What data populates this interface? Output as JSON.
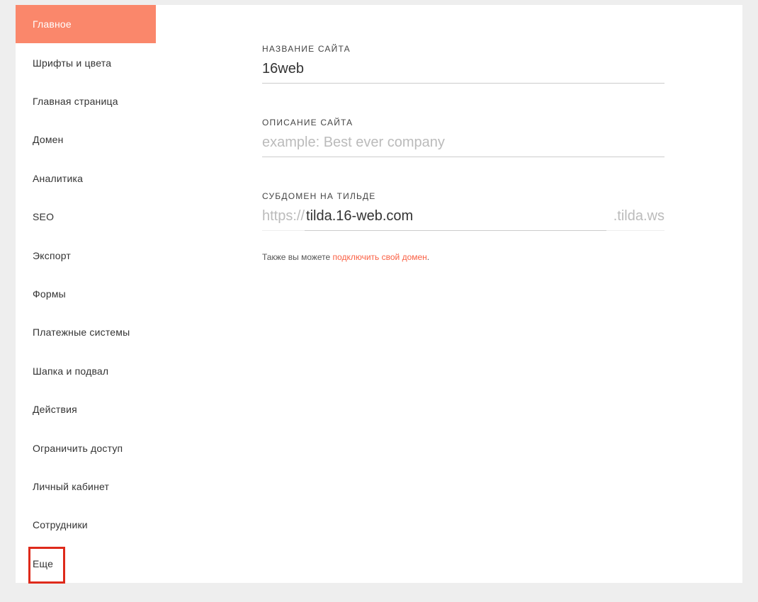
{
  "sidebar": {
    "items": [
      {
        "label": "Главное",
        "active": true
      },
      {
        "label": "Шрифты и цвета",
        "active": false
      },
      {
        "label": "Главная страница",
        "active": false
      },
      {
        "label": "Домен",
        "active": false
      },
      {
        "label": "Аналитика",
        "active": false
      },
      {
        "label": "SEO",
        "active": false
      },
      {
        "label": "Экспорт",
        "active": false
      },
      {
        "label": "Формы",
        "active": false
      },
      {
        "label": "Платежные системы",
        "active": false
      },
      {
        "label": "Шапка и подвал",
        "active": false
      },
      {
        "label": "Действия",
        "active": false
      },
      {
        "label": "Ограничить доступ",
        "active": false
      },
      {
        "label": "Личный кабинет",
        "active": false
      },
      {
        "label": "Сотрудники",
        "active": false
      },
      {
        "label": "Еще",
        "active": false
      }
    ]
  },
  "main": {
    "site_name": {
      "label": "НАЗВАНИЕ САЙТА",
      "value": "16web"
    },
    "site_description": {
      "label": "ОПИСАНИЕ САЙТА",
      "value": "",
      "placeholder": "example: Best ever company"
    },
    "subdomain": {
      "label": "СУБДОМЕН НА ТИЛЬДЕ",
      "prefix": "https://",
      "value": "tilda.16-web.com",
      "suffix": ".tilda.ws"
    },
    "help": {
      "text": "Также вы можете ",
      "link": "подключить свой домен",
      "tail": "."
    }
  }
}
